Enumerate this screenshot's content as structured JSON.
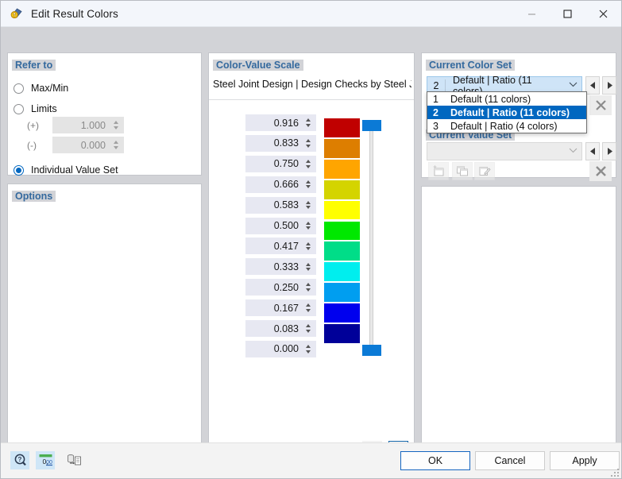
{
  "window": {
    "title": "Edit Result Colors",
    "icon": "color-palette-icon",
    "controls": {
      "minimize": "—",
      "maximize": "☐",
      "close": "✕"
    }
  },
  "refer_to": {
    "title": "Refer to",
    "options": [
      {
        "label": "Max/Min",
        "selected": false
      },
      {
        "label": "Limits",
        "selected": false
      },
      {
        "label": "Individual Value Set",
        "selected": true
      }
    ],
    "limits": {
      "plus_sign": "(+)",
      "plus_value": "1.000",
      "minus_sign": "(-)",
      "minus_value": "0.000"
    }
  },
  "options": {
    "title": "Options"
  },
  "color_value_scale": {
    "title": "Color-Value Scale",
    "caption": "Steel Joint Design | Design Checks by Steel Joints",
    "toggles": [
      {
        "name": "gradient-scale-mode",
        "selected": false
      },
      {
        "name": "stepped-scale-mode",
        "selected": true
      }
    ],
    "rows": [
      {
        "value": "0.916",
        "color": "#c00000"
      },
      {
        "value": "0.833",
        "color": "#dd7e00"
      },
      {
        "value": "0.750",
        "color": "#ffa500"
      },
      {
        "value": "0.666",
        "color": "#d4d400"
      },
      {
        "value": "0.583",
        "color": "#ffff00"
      },
      {
        "value": "0.500",
        "color": "#00e800"
      },
      {
        "value": "0.417",
        "color": "#00dd88"
      },
      {
        "value": "0.333",
        "color": "#00eeee"
      },
      {
        "value": "0.250",
        "color": "#009ef0"
      },
      {
        "value": "0.167",
        "color": "#0000ee"
      },
      {
        "value": "0.083",
        "color": "#000099"
      },
      {
        "value": "0.000",
        "color": null
      }
    ],
    "slider": {
      "thumb_color": "#0b7ad6"
    }
  },
  "current_color_set": {
    "title": "Current Color Set",
    "selected": {
      "index": "2",
      "label": "Default | Ratio (11 colors)"
    },
    "chevron": "⌄",
    "nav_prev": "◀",
    "nav_next": "▶",
    "delete": "✕",
    "dropdown_open": true,
    "dropdown_items": [
      {
        "index": "1",
        "label": "Default (11 colors)",
        "selected": false
      },
      {
        "index": "2",
        "label": "Default | Ratio (11 colors)",
        "selected": true
      },
      {
        "index": "3",
        "label": "Default | Ratio (4 colors)",
        "selected": false
      }
    ]
  },
  "current_value_set": {
    "title": "Current Value Set",
    "selected": "",
    "chevron": "⌄",
    "nav_prev": "◀",
    "nav_next": "▶",
    "delete": "✕",
    "tools": [
      {
        "name": "new-value-set-icon"
      },
      {
        "name": "copy-value-set-icon"
      },
      {
        "name": "edit-value-set-icon"
      }
    ]
  },
  "footer": {
    "icons": [
      {
        "name": "help-icon"
      },
      {
        "name": "number-format-icon"
      },
      {
        "name": "export-data-icon"
      }
    ],
    "ok": "OK",
    "cancel": "Cancel",
    "apply": "Apply"
  },
  "colors": {
    "accent": "#0067c0",
    "section_title": "#34699e",
    "dialog_bg": "#d2d3d7"
  }
}
